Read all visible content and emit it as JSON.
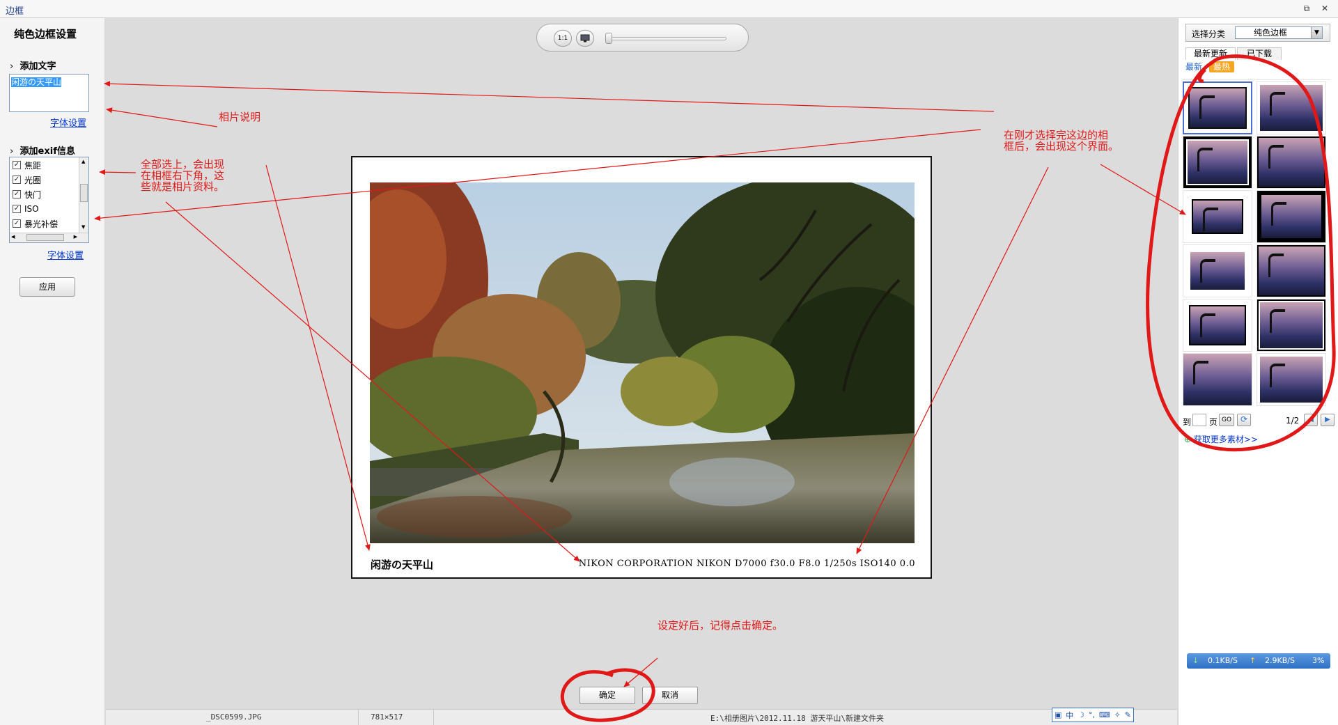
{
  "window": {
    "title": "边框"
  },
  "left_panel": {
    "title": "纯色边框设置",
    "add_text_label": "添加文字",
    "caption_value": "闲游の天平山",
    "font_settings_label": "字体设置",
    "add_exif_label": "添加exif信息",
    "exif_items": [
      {
        "label": "焦距",
        "checked": true
      },
      {
        "label": "光圈",
        "checked": true
      },
      {
        "label": "快门",
        "checked": true
      },
      {
        "label": "ISO",
        "checked": true
      },
      {
        "label": "暴光补偿",
        "checked": true
      }
    ],
    "exif_font_settings_label": "字体设置",
    "apply_label": "应用"
  },
  "toolbar": {
    "actual_size_label": "1:1"
  },
  "preview": {
    "caption": "闲游の天平山",
    "exif_text": "NIKON CORPORATION NIKON D7000 f30.0 F8.0 1/250s ISO140 0.0"
  },
  "actions": {
    "ok_label": "确定",
    "cancel_label": "取消"
  },
  "status_bar": {
    "filename": "_DSC0599.JPG",
    "dimensions": "781×517",
    "path": "E:\\相册图片\\2012.11.18 游天平山\\新建文件夹"
  },
  "ime_bar": {
    "mode": "中"
  },
  "right_panel": {
    "category_label": "选择分类",
    "category_value": "纯色边框",
    "tabs": [
      "最新更新",
      "已下载"
    ],
    "subtabs": [
      "最新",
      "最热"
    ],
    "pager": {
      "jump_label_pre": "到",
      "jump_label_post": "页",
      "go_label": "GO",
      "page_status": "1/2"
    },
    "more_link": "获取更多素材>>",
    "net_speed": {
      "down": "0.1KB/S",
      "up": "2.9KB/S",
      "percent": "3%"
    }
  },
  "annotations": {
    "photo_caption_note": "相片说明",
    "exif_note": "全部选上，会出现\n在相框右下角，这\n些就是相片资料。",
    "frame_select_note": "在刚才选择完这边的相\n框后，会出现这个界面。",
    "confirm_note": "设定好后，记得点击确定。"
  },
  "colors": {
    "annotation_red": "#e01818",
    "link_blue": "#0033cc",
    "selection_blue": "#3399ff"
  }
}
